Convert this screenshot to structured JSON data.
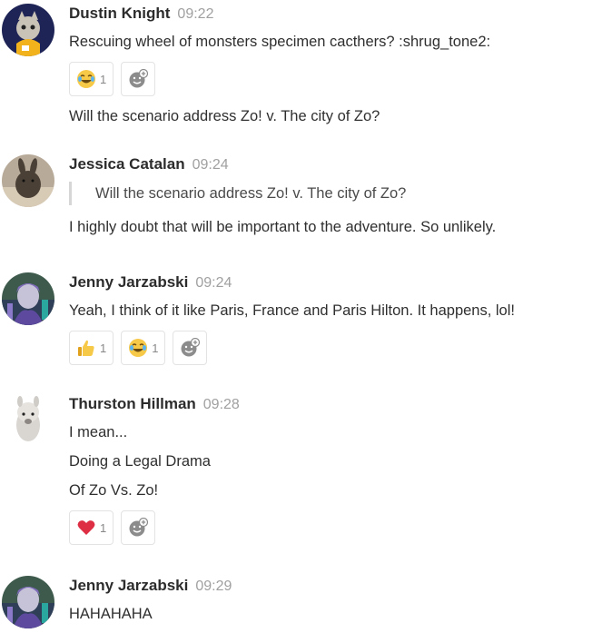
{
  "colors": {
    "author": "#2c2c2c",
    "time": "#a0a0a0",
    "text": "#2f2f2f",
    "quote_bar": "#d6d6d6",
    "reaction_border": "#e3e3e3"
  },
  "messages": [
    {
      "author": "Dustin Knight",
      "time": "09:22",
      "avatar": "dustin-avatar",
      "lines": [
        "Rescuing wheel of monsters specimen cacthers? :shrug_tone2:"
      ],
      "reactions": [
        {
          "icon": "joy-emoji",
          "count": "1"
        }
      ],
      "after_lines": [
        "Will the scenario address Zo! v. The city of Zo?"
      ]
    },
    {
      "author": "Jessica Catalan",
      "time": "09:24",
      "avatar": "jessica-avatar",
      "quote": "Will the scenario address Zo! v. The city of Zo?",
      "lines": [
        "I highly doubt that will be important to the adventure. So unlikely."
      ]
    },
    {
      "author": "Jenny Jarzabski",
      "time": "09:24",
      "avatar": "jenny-avatar",
      "lines": [
        "Yeah, I think of it like Paris, France and Paris Hilton. It happens, lol!"
      ],
      "reactions": [
        {
          "icon": "thumbs-up-emoji",
          "count": "1"
        },
        {
          "icon": "joy-emoji",
          "count": "1"
        }
      ]
    },
    {
      "author": "Thurston Hillman",
      "time": "09:28",
      "avatar": "thurston-avatar",
      "lines": [
        "I mean...",
        "Doing a Legal Drama",
        "Of Zo Vs. Zo!"
      ],
      "reactions": [
        {
          "icon": "heart-emoji",
          "count": "1"
        }
      ]
    },
    {
      "author": "Jenny Jarzabski",
      "time": "09:29",
      "avatar": "jenny-avatar",
      "lines": [
        "HAHAHAHA"
      ]
    }
  ]
}
